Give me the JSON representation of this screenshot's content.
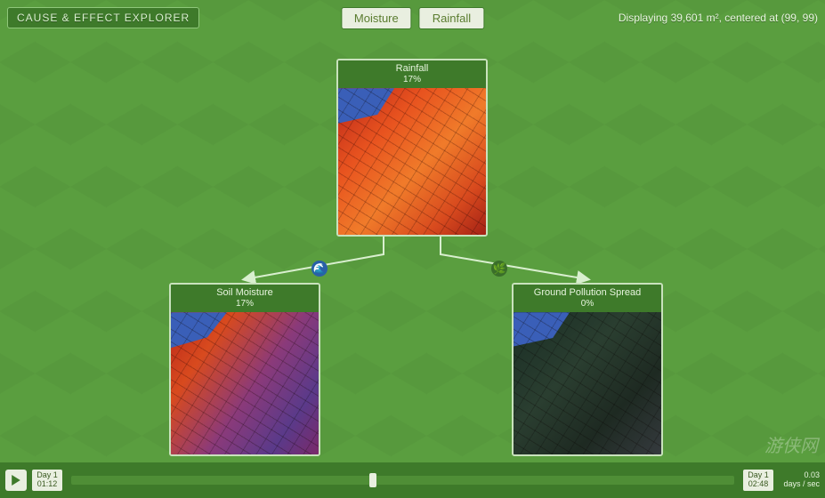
{
  "header": {
    "title": "CAUSE & EFFECT EXPLORER",
    "breadcrumbs": [
      "Moisture",
      "Rainfall"
    ],
    "info": "Displaying 39,601 m², centered at (99, 99)"
  },
  "nodes": {
    "root": {
      "title": "Rainfall",
      "value": "17%"
    },
    "left": {
      "title": "Soil Moisture",
      "value": "17%"
    },
    "right": {
      "title": "Ground Pollution Spread",
      "value": "0%"
    }
  },
  "edge_icons": {
    "left": "🌊",
    "right": "🌿"
  },
  "timeline": {
    "play_state": "paused",
    "start": {
      "label": "Day 1",
      "time": "01:12"
    },
    "end": {
      "label": "Day 1",
      "time": "02:48"
    },
    "speed_value": "0.03",
    "speed_unit": "days / sec",
    "progress_pct": 45
  },
  "watermark": "游侠网"
}
